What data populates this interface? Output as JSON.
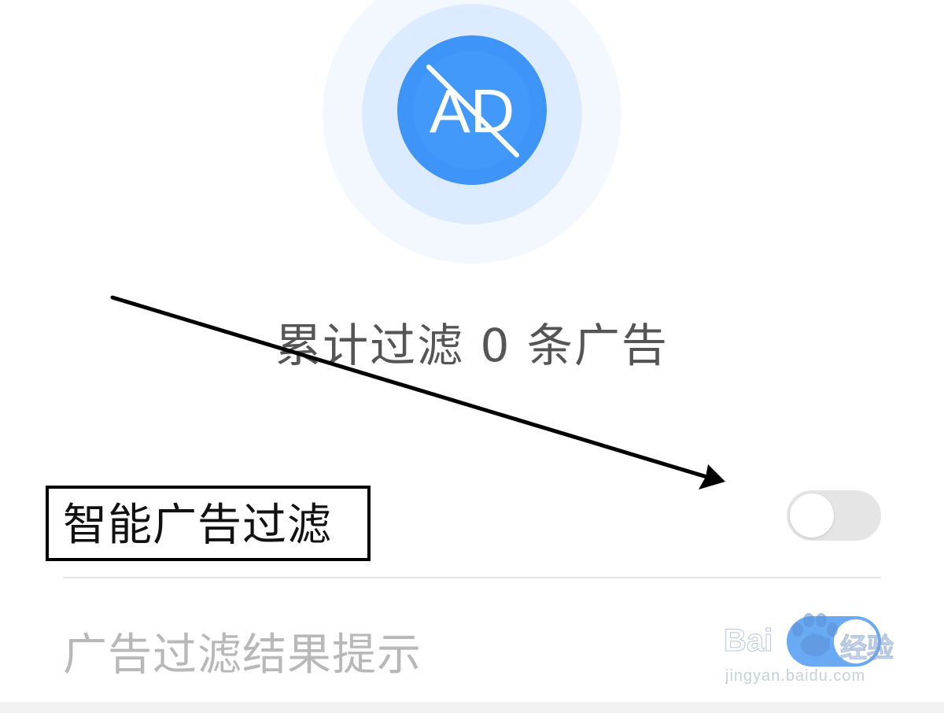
{
  "hero": {
    "icon": "ad-block-icon",
    "icon_text": "AD",
    "colors": {
      "outer_halo": "#f3f8ff",
      "mid_halo": "#dcebff",
      "inner_circle": "#3f94f8"
    }
  },
  "summary": {
    "text": "累计过滤 0 条广告"
  },
  "settings": [
    {
      "label": "智能广告过滤",
      "toggle_state": "off"
    },
    {
      "label": "广告过滤结果提示",
      "toggle_state": "on"
    }
  ],
  "annotations": {
    "arrow": "black-arrow-pointing-to-toggle",
    "highlight_box": "black-rectangle-around-smart-ad-filter"
  },
  "watermark": {
    "brand_left": "Bai",
    "brand_mid": "du",
    "brand_right": "经验",
    "url": "jingyan.baidu.com"
  }
}
